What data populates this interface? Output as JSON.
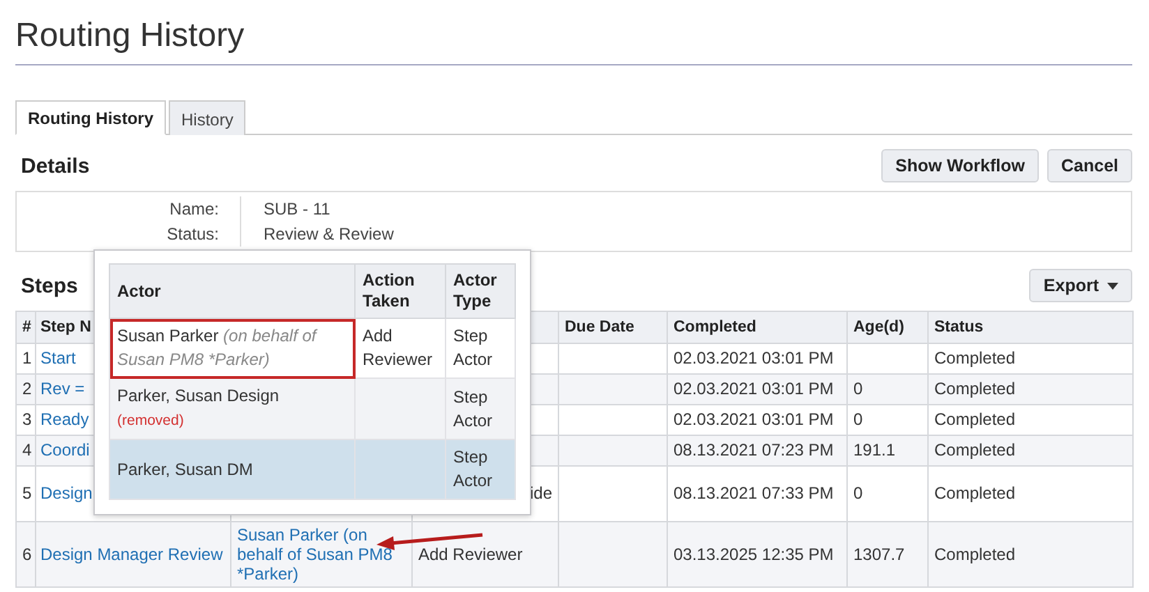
{
  "page_title": "Routing History",
  "tabs": [
    {
      "label": "Routing History",
      "selected": true
    },
    {
      "label": "History",
      "selected": false
    }
  ],
  "details": {
    "title": "Details",
    "buttons": [
      "Show Workflow",
      "Cancel"
    ],
    "fields": [
      {
        "label": "Name:",
        "value": "SUB - 11"
      },
      {
        "label": "Status:",
        "value": "Review & Review"
      }
    ]
  },
  "steps": {
    "title": "Steps",
    "export_button": "Export",
    "columns": {
      "column_1": "#",
      "column_2": "Step N",
      "column_5": "Due Date",
      "column_6": "Completed",
      "column_7": "Age(d)",
      "column_8": "Status"
    },
    "rows": [
      {
        "column_1": "1",
        "column_2": "Start",
        "column_6": "02.03.2021 03:01 PM",
        "column_8": "Completed"
      },
      {
        "column_1": "2",
        "column_2": "Rev =",
        "column_6": "02.03.2021 03:01 PM",
        "column_7": "0",
        "column_8": "Completed"
      },
      {
        "column_1": "3",
        "column_2": "Ready",
        "column_6": "02.03.2021 03:01 PM",
        "column_7": "0",
        "column_8": "Completed"
      },
      {
        "column_1": "4",
        "column_2": "Coordi",
        "column_6": "08.13.2021 07:23 PM",
        "column_7": "191.1",
        "column_8": "Completed"
      },
      {
        "column_1": "5",
        "column_2": "Design",
        "column_4": "ide",
        "column_6": "08.13.2021 07:33 PM",
        "column_7": "0",
        "column_8": "Completed"
      },
      {
        "column_1": "6",
        "column_2": "Design Manager Review",
        "column_3": "Susan Parker (on behalf of Susan PM8 *Parker)",
        "column_4": "Add Reviewer",
        "column_6": "03.13.2025 12:35 PM",
        "column_7": "1307.7",
        "column_8": "Completed"
      }
    ]
  },
  "popover": {
    "columns": [
      "Actor",
      "Action Taken",
      "Actor Type"
    ],
    "rows": [
      {
        "actor": "Susan Parker",
        "note": {
          "text": "(on behalf of Susan PM8 *Parker)",
          "kind": "behalf"
        },
        "action": "Add Reviewer",
        "type": "Step Actor",
        "outlined": true,
        "highlighted": false
      },
      {
        "actor": "Parker, Susan Design",
        "note": {
          "text": "(removed)",
          "kind": "removed"
        },
        "type": "Step Actor",
        "outlined": false,
        "highlighted": false
      },
      {
        "actor": "Parker, Susan DM",
        "type": "Step Actor",
        "outlined": false,
        "highlighted": true
      }
    ]
  }
}
